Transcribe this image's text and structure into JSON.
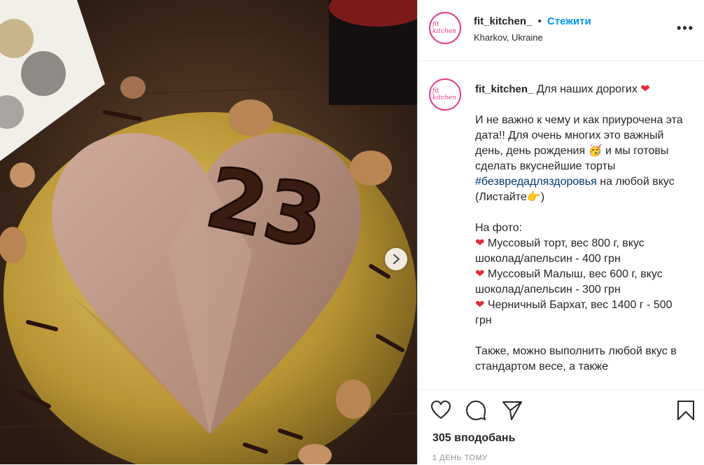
{
  "post": {
    "photo_label": "23",
    "next_icon": "chevron-right-icon"
  },
  "header": {
    "username": "fit_kitchen_",
    "separator": "•",
    "follow_label": "Стежити",
    "location": "Kharkov, Ukraine",
    "avatar_text": "fit kitchen",
    "more_icon": "•••"
  },
  "caption": {
    "username": "fit_kitchen_",
    "intro": "Для наших дорогих",
    "heart": "❤",
    "p1": "И не важно к чему и как приурочена эта дата!! Для очень многих это важный день, день рождения 🥳 и мы готовы сделать вкуснейшие торты",
    "hashtag": "#безвредадляздоровья",
    "p1_end": "на любой вкус (Листайте👉)",
    "photo_label": "На фото:",
    "item1": "Муссовый торт, вес 800 г, вкус шоколад/апельсин - 400 грн",
    "item2": "Муссовый Малыш, вес 600 г, вкус шоколад/апельсин - 300 грн",
    "item3": "Черничный Бархат, вес 1400 г - 500 грн",
    "p_last": "Также, можно выполнить любой вкус в стандартом весе, а также"
  },
  "actions": {
    "like_icon": "heart-icon",
    "comment_icon": "comment-icon",
    "share_icon": "share-icon",
    "save_icon": "bookmark-icon",
    "likes_text": "305 вподобань",
    "time_text": "1 ДЕНЬ ТОМУ"
  },
  "colors": {
    "accent": "#0095f6",
    "text": "#262626",
    "muted": "#8e8e8e",
    "heart": "#e02b3a"
  }
}
